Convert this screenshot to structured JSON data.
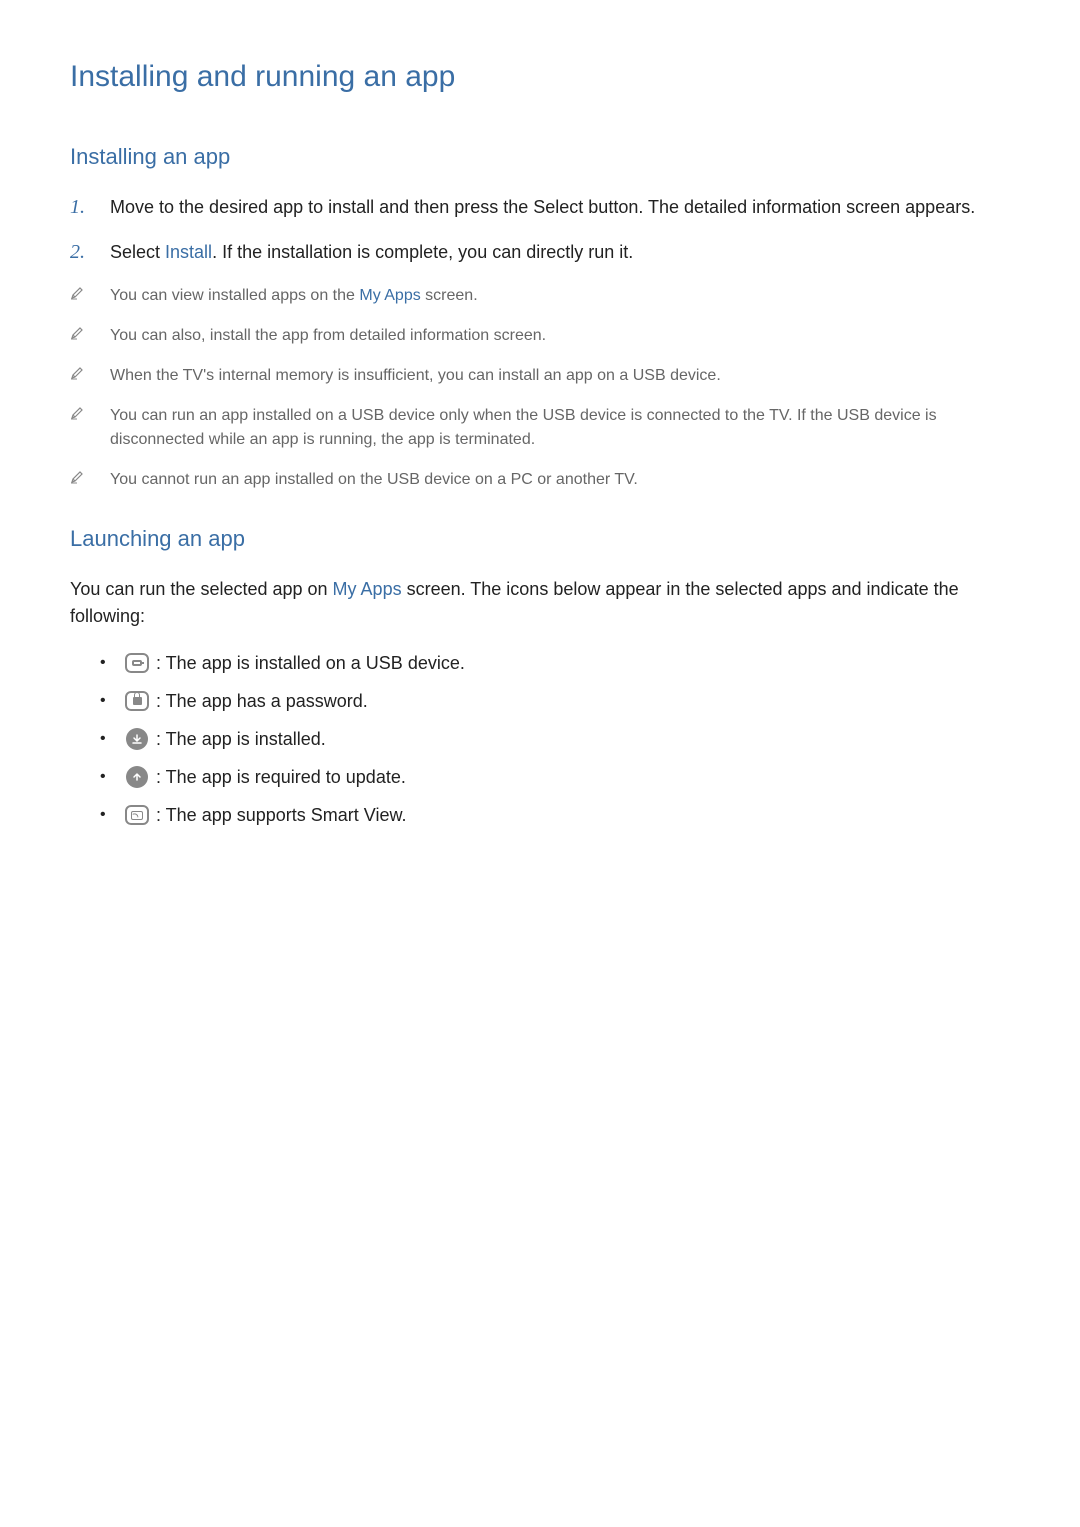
{
  "h1": "Installing and running an app",
  "section1": {
    "h2": "Installing an app",
    "steps": [
      {
        "num": "1.",
        "text_before": "Move to the desired app to install and then press the Select button. The detailed information screen appears.",
        "link": "",
        "text_after": ""
      },
      {
        "num": "2.",
        "text_before": "Select ",
        "link": "Install",
        "text_after": ". If the installation is complete, you can directly run it."
      }
    ],
    "notes": [
      {
        "text_before": "You can view installed apps on the ",
        "link": "My Apps",
        "text_after": " screen."
      },
      {
        "text_before": "You can also, install the app from detailed information screen.",
        "link": "",
        "text_after": ""
      },
      {
        "text_before": "When the TV's internal memory is insufficient, you can install an app on a USB device.",
        "link": "",
        "text_after": ""
      },
      {
        "text_before": "You can run an app installed on a USB device only when the USB device is connected to the TV. If the USB device is disconnected while an app is running, the app is terminated.",
        "link": "",
        "text_after": ""
      },
      {
        "text_before": "You cannot run an app installed on the USB device on a PC or another TV.",
        "link": "",
        "text_after": ""
      }
    ]
  },
  "section2": {
    "h2": "Launching an app",
    "intro_before": "You can run the selected app on ",
    "intro_link": "My Apps",
    "intro_after": " screen. The icons below appear in the selected apps and indicate the following:",
    "icons": [
      {
        "name": "usb-icon",
        "desc": " : The app is installed on a USB device."
      },
      {
        "name": "lock-icon",
        "desc": " : The app has a password."
      },
      {
        "name": "installed-icon",
        "desc": " : The app is installed."
      },
      {
        "name": "update-icon",
        "desc": " : The app is required to update."
      },
      {
        "name": "smartview-icon",
        "desc": " : The app supports Smart View."
      }
    ]
  }
}
